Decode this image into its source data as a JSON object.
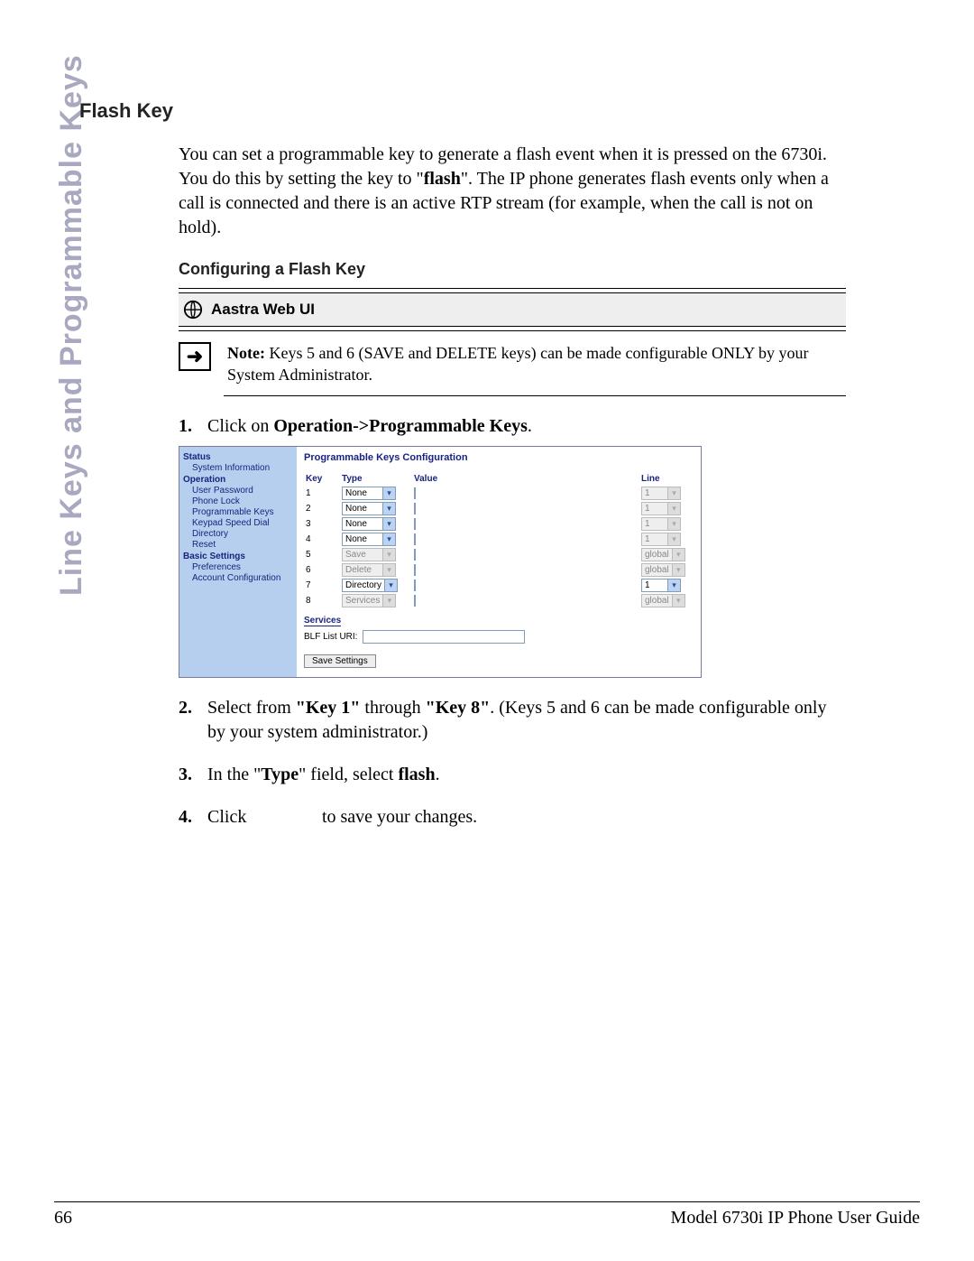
{
  "side_label": "Line Keys and Programmable Keys",
  "headings": {
    "flash_key": "Flash Key",
    "configuring": "Configuring a Flash Key",
    "webui": "Aastra Web UI"
  },
  "paragraphs": {
    "intro_1": "You can set a programmable key to generate a flash event when it is pressed on the 6730i. You do this by setting the key to \"",
    "intro_bold": "flash",
    "intro_2": "\". The IP phone generates flash events only when a call is connected and there is an active RTP stream (for example, when the call is not on hold)."
  },
  "note": {
    "label": "Note:",
    "text": " Keys 5 and 6 (SAVE and DELETE keys) can be made configurable ONLY by your System Administrator."
  },
  "steps": {
    "s1_a": "Click on ",
    "s1_b": "Operation->Programmable Keys",
    "s1_c": ".",
    "s2_a": "Select from ",
    "s2_b": "\"Key 1\"",
    "s2_c": " through ",
    "s2_d": "\"Key 8\"",
    "s2_e": ". (Keys 5 and 6 can be made configurable only by your system administrator.)",
    "s3_a": "In the \"",
    "s3_b": "Type",
    "s3_c": "\" field, select ",
    "s3_d": "flash",
    "s3_e": ".",
    "s4_a": "Click ",
    "s4_gap": "               ",
    "s4_b": " to save your changes."
  },
  "screenshot": {
    "nav": {
      "status": "Status",
      "status_items": [
        "System Information"
      ],
      "operation": "Operation",
      "operation_items": [
        "User Password",
        "Phone Lock",
        "Programmable Keys",
        "Keypad Speed Dial",
        "Directory",
        "Reset"
      ],
      "basic": "Basic Settings",
      "basic_items": [
        "Preferences",
        "Account Configuration"
      ]
    },
    "title": "Programmable Keys Configuration",
    "headers": {
      "key": "Key",
      "type": "Type",
      "value": "Value",
      "line": "Line"
    },
    "rows": [
      {
        "key": "1",
        "type": "None",
        "line": "1",
        "disabled": false
      },
      {
        "key": "2",
        "type": "None",
        "line": "1",
        "disabled": false
      },
      {
        "key": "3",
        "type": "None",
        "line": "1",
        "disabled": false
      },
      {
        "key": "4",
        "type": "None",
        "line": "1",
        "disabled": false
      },
      {
        "key": "5",
        "type": "Save",
        "line": "global",
        "disabled": true
      },
      {
        "key": "6",
        "type": "Delete",
        "line": "global",
        "disabled": true
      },
      {
        "key": "7",
        "type": "Directory",
        "line": "1",
        "disabled": false
      },
      {
        "key": "8",
        "type": "Services",
        "line": "global",
        "disabled": true
      }
    ],
    "services": "Services",
    "blf_label": "BLF List URI:",
    "save_button": "Save Settings"
  },
  "footer": {
    "page": "66",
    "doc": "Model 6730i IP Phone User Guide"
  }
}
